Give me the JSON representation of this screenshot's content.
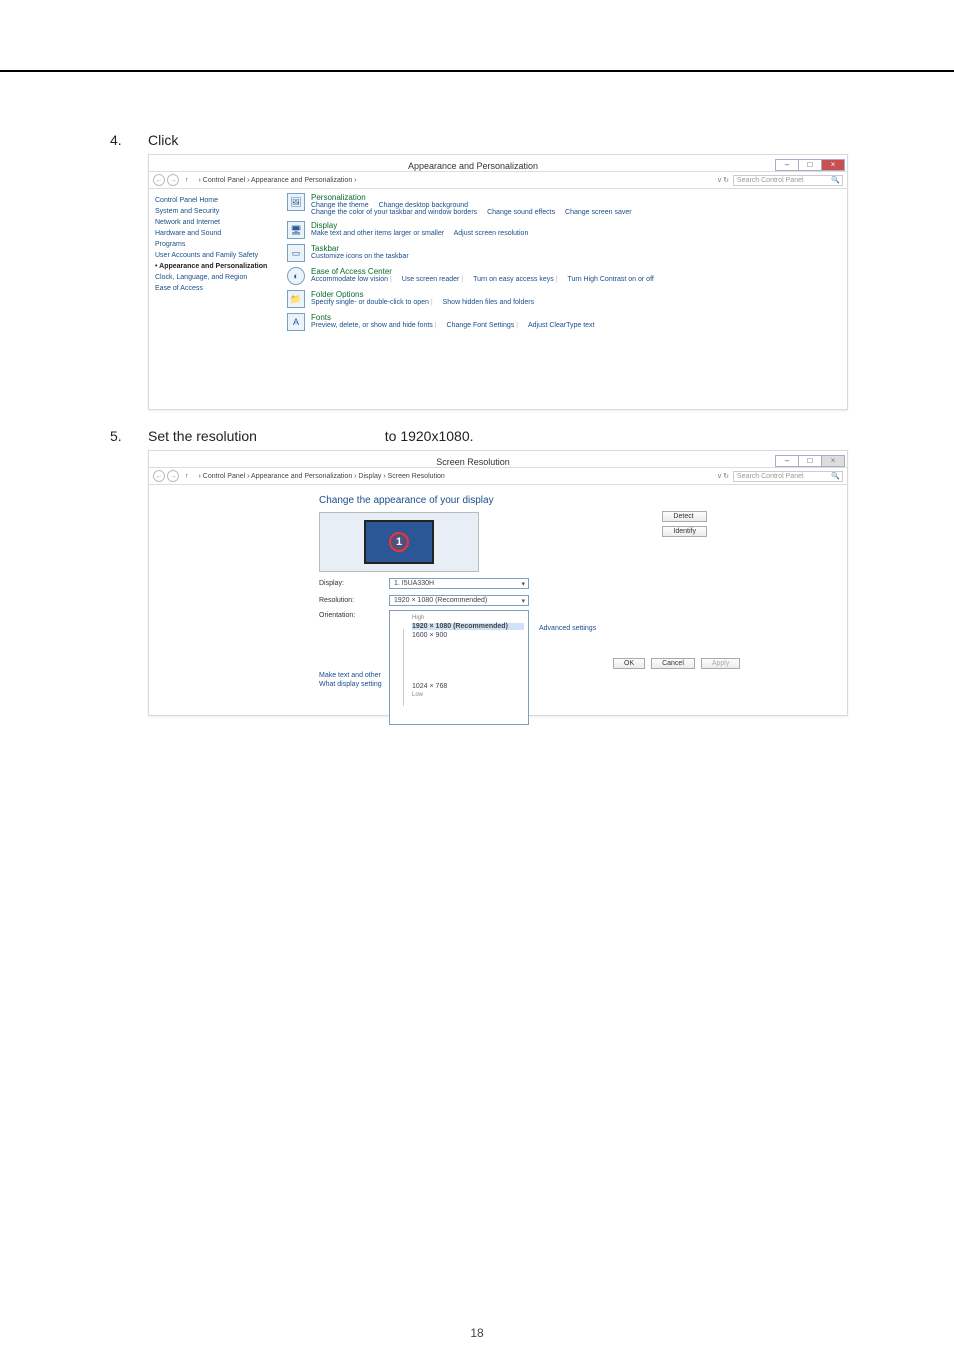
{
  "page_number": "18",
  "steps": {
    "s4": {
      "num": "4.",
      "text": "Click"
    },
    "s5": {
      "num": "5.",
      "text_a": "Set the resolution",
      "text_b": "to 1920x1080."
    }
  },
  "shot1": {
    "title": "Appearance and Personalization",
    "breadcrumb": "› Control Panel › Appearance and Personalization ›",
    "search_placeholder": "Search Control Panel",
    "refresh_glyph": "⟳",
    "vc": "v  ↻",
    "win_close": "×",
    "sidebar": {
      "home": "Control Panel Home",
      "sys": "System and Security",
      "net": "Network and Internet",
      "hw": "Hardware and Sound",
      "prog": "Programs",
      "users": "User Accounts and Family Safety",
      "appear": "Appearance and Personalization",
      "clock": "Clock, Language, and Region",
      "ease": "Ease of Access"
    },
    "cats": {
      "pers": {
        "h": "Personalization",
        "l1": "Change the theme",
        "l2": "Change desktop background",
        "l3": "Change the color of your taskbar and window borders",
        "l4": "Change sound effects",
        "l5": "Change screen saver"
      },
      "disp": {
        "h": "Display",
        "l1": "Make text and other items larger or smaller",
        "l2": "Adjust screen resolution"
      },
      "task": {
        "h": "Taskbar",
        "l1": "Customize icons on the taskbar"
      },
      "eac": {
        "h": "Ease of Access Center",
        "l1": "Accommodate low vision",
        "l2": "Use screen reader",
        "l3": "Turn on easy access keys",
        "l4": "Turn High Contrast on or off"
      },
      "folder": {
        "h": "Folder Options",
        "l1": "Specify single- or double-click to open",
        "l2": "Show hidden files and folders"
      },
      "fonts": {
        "h": "Fonts",
        "l1": "Preview, delete, or show and hide fonts",
        "l2": "Change Font Settings",
        "l3": "Adjust ClearType text"
      }
    }
  },
  "shot2": {
    "title": "Screen Resolution",
    "breadcrumb": "› Control Panel › Appearance and Personalization › Display › Screen Resolution",
    "search_placeholder": "Search Control Panel",
    "vc": "v  ↻",
    "win_close": "×",
    "heading": "Change the appearance of your display",
    "buttons": {
      "detect": "Detect",
      "identify": "Identify",
      "ok": "OK",
      "cancel": "Cancel",
      "apply": "Apply"
    },
    "rows": {
      "display_label": "Display:",
      "display_value": "1. I5UA330H",
      "res_label": "Resolution:",
      "res_value": "1920 × 1080 (Recommended)",
      "orient_label": "Orientation:"
    },
    "adv": "Advanced settings",
    "links": {
      "a": "Make text and other",
      "b": "What display setting"
    },
    "dropdown": {
      "high": "High",
      "rec": "1920 × 1080 (Recommended)",
      "o2": "1600 × 900",
      "o3": "1024 × 768",
      "low": "Low"
    },
    "monitor_label": "1"
  }
}
